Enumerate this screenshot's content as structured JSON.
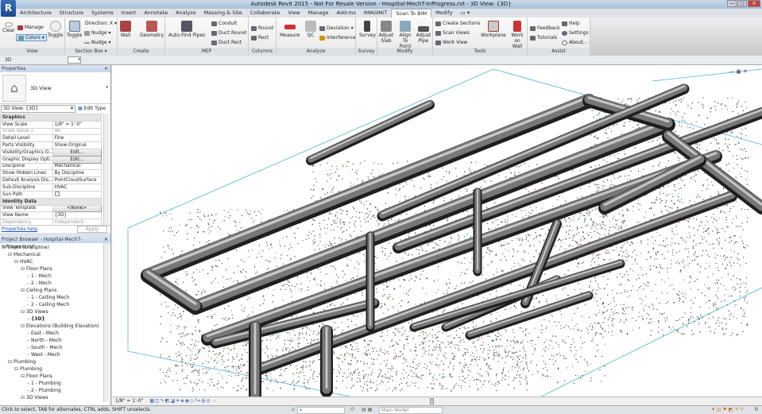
{
  "window": {
    "app_button": "R",
    "title": "Autodesk Revit 2015 - Not For Resale Version -  Hospital-MechT-InProgress.rvt - 3D View: {3D}",
    "min": "—",
    "max": "□",
    "close": "✕"
  },
  "tabs": [
    "Architecture",
    "Structure",
    "Systems",
    "Insert",
    "Annotate",
    "Analyze",
    "Massing & Site",
    "Collaborate",
    "View",
    "Manage",
    "Add-Ins",
    "IMAGINiT",
    "Scan To BIM",
    "Modify",
    "▭ ▾"
  ],
  "active_tab": "Scan To BIM",
  "ribbon": {
    "view": {
      "label": "View",
      "clear": "Clear",
      "manage": "Manage",
      "colors": "Colors ▾",
      "toggle": "Toggle"
    },
    "section_box": {
      "label": "Section Box ▾",
      "toggle": "Toggle",
      "direction": "Direction: X ▾",
      "nudge_up": "Nudge ▾",
      "nudge_down": "Nudge ▾"
    },
    "create": {
      "label": "Create",
      "wall": "Wall",
      "geometry": "Geometry"
    },
    "mep": {
      "label": "MEP",
      "auto_find": "Auto-Find Pipes",
      "conduit": "Conduit",
      "duct_round": "Duct Round",
      "duct_rect": "Duct Rect"
    },
    "columns": {
      "label": "Columns",
      "round": "Round",
      "rect": "Rect"
    },
    "analyze": {
      "label": "Analyze",
      "measure": "Measure",
      "qc": "QC",
      "deviation": "Deviation ▾",
      "interference": "Interference"
    },
    "survey": {
      "label": "Survey",
      "survey": "Survey"
    },
    "modify": {
      "label": "Modify",
      "adjust_slab": "Adjust Slab",
      "align": "Align To Point",
      "adjust_pipe": "Adjust Pipe"
    },
    "tools": {
      "label": "Tools",
      "create_sections": "Create Sections",
      "scan_views": "Scan Views",
      "work_view": "Work View",
      "workplane": "Workplane",
      "work_on_wall": "Work on Wall"
    },
    "assist": {
      "label": "Assist",
      "feedback": "Feedback",
      "tutorials": "Tutorials",
      "help": "Help",
      "settings": "Settings",
      "about": "About..."
    }
  },
  "options_bar": {
    "view_name": "3D"
  },
  "properties": {
    "title": "Properties",
    "close": "✕",
    "type_name": "3D View",
    "instance": "3D View: {3D}",
    "edit_type": "Edit Type",
    "groups": [
      {
        "name": "Graphics",
        "rows": [
          [
            "View Scale",
            "1/8\" = 1'-0\""
          ],
          [
            "Scale Value    1:",
            "96"
          ],
          [
            "Detail Level",
            "Fine"
          ],
          [
            "Parts Visibility",
            "Show Original"
          ],
          [
            "Visibility/Graphics O...",
            "Edit..."
          ],
          [
            "Graphic Display Opti...",
            "Edit..."
          ],
          [
            "Discipline",
            "Mechanical"
          ],
          [
            "Show Hidden Lines",
            "By Discipline"
          ],
          [
            "Default Analysis Dis...",
            "PointCloudSurface"
          ],
          [
            "Sub-Discipline",
            "HVAC"
          ],
          [
            "Sun Path",
            ""
          ]
        ]
      },
      {
        "name": "Identity Data",
        "rows": [
          [
            "View Template",
            "<None>"
          ],
          [
            "View Name",
            "{3D}"
          ],
          [
            "Dependency",
            "Independent"
          ]
        ]
      }
    ],
    "help_link": "Properties help",
    "apply": "Apply"
  },
  "project_browser": {
    "title": "Project Browser - Hospital-MechT-InProgress.rvt",
    "close": "✕",
    "items": [
      {
        "depth": 0,
        "label": "Views (Discipline)"
      },
      {
        "depth": 1,
        "label": "Mechanical"
      },
      {
        "depth": 2,
        "label": "HVAC"
      },
      {
        "depth": 3,
        "label": "Floor Plans"
      },
      {
        "depth": 4,
        "label": "1 - Mech"
      },
      {
        "depth": 4,
        "label": "2 - Mech"
      },
      {
        "depth": 3,
        "label": "Ceiling Plans"
      },
      {
        "depth": 4,
        "label": "1 - Ceiling Mech"
      },
      {
        "depth": 4,
        "label": "2 - Ceiling Mech"
      },
      {
        "depth": 3,
        "label": "3D Views"
      },
      {
        "depth": 4,
        "label": "{3D}"
      },
      {
        "depth": 3,
        "label": "Elevations (Building Elevation)"
      },
      {
        "depth": 4,
        "label": "East - Mech"
      },
      {
        "depth": 4,
        "label": "North - Mech"
      },
      {
        "depth": 4,
        "label": "South - Mech"
      },
      {
        "depth": 4,
        "label": "West - Mech"
      },
      {
        "depth": 1,
        "label": "Plumbing"
      },
      {
        "depth": 2,
        "label": "Plumbing"
      },
      {
        "depth": 3,
        "label": "Floor Plans"
      },
      {
        "depth": 4,
        "label": "1 - Plumbing"
      },
      {
        "depth": 4,
        "label": "2 - Plumbing"
      },
      {
        "depth": 3,
        "label": "3D Views"
      }
    ]
  },
  "view_control": {
    "scale": "1/8\" = 1'-0\""
  },
  "status": {
    "message": "Click to select, TAB for alternates, CTRL adds, SHIFT unselects.",
    "worksets_count": ":0",
    "model": "Main Model",
    "filter_count": "0"
  }
}
